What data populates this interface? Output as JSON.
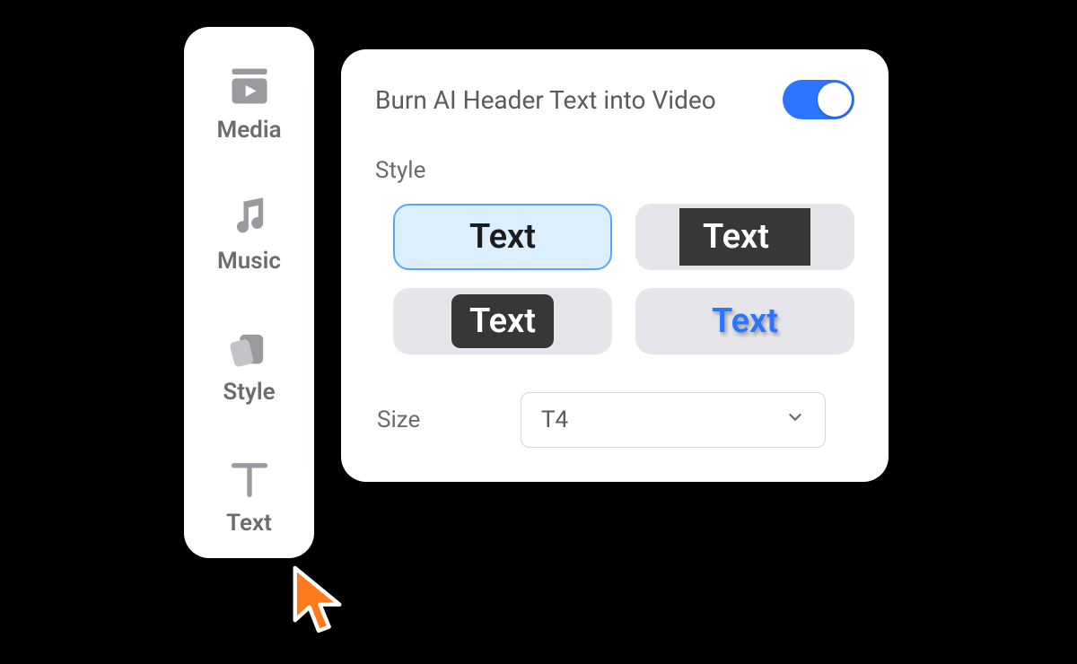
{
  "sidebar": {
    "items": [
      {
        "label": "Media",
        "icon": "media-icon"
      },
      {
        "label": "Music",
        "icon": "music-icon"
      },
      {
        "label": "Style",
        "icon": "style-icon"
      },
      {
        "label": "Text",
        "icon": "text-icon"
      }
    ],
    "active_index": 3
  },
  "panel": {
    "toggle_label": "Burn AI Header Text into Video",
    "toggle_on": true,
    "style_section_label": "Style",
    "style_sample_text": "Text",
    "style_options": [
      {
        "id": "plain",
        "selected": true
      },
      {
        "id": "box-dark",
        "selected": false
      },
      {
        "id": "pill-dark",
        "selected": false
      },
      {
        "id": "blue-shadow",
        "selected": false
      }
    ],
    "size_label": "Size",
    "size_value": "T4"
  },
  "colors": {
    "accent": "#2d74ff",
    "cursor": "#ff7a1a"
  }
}
